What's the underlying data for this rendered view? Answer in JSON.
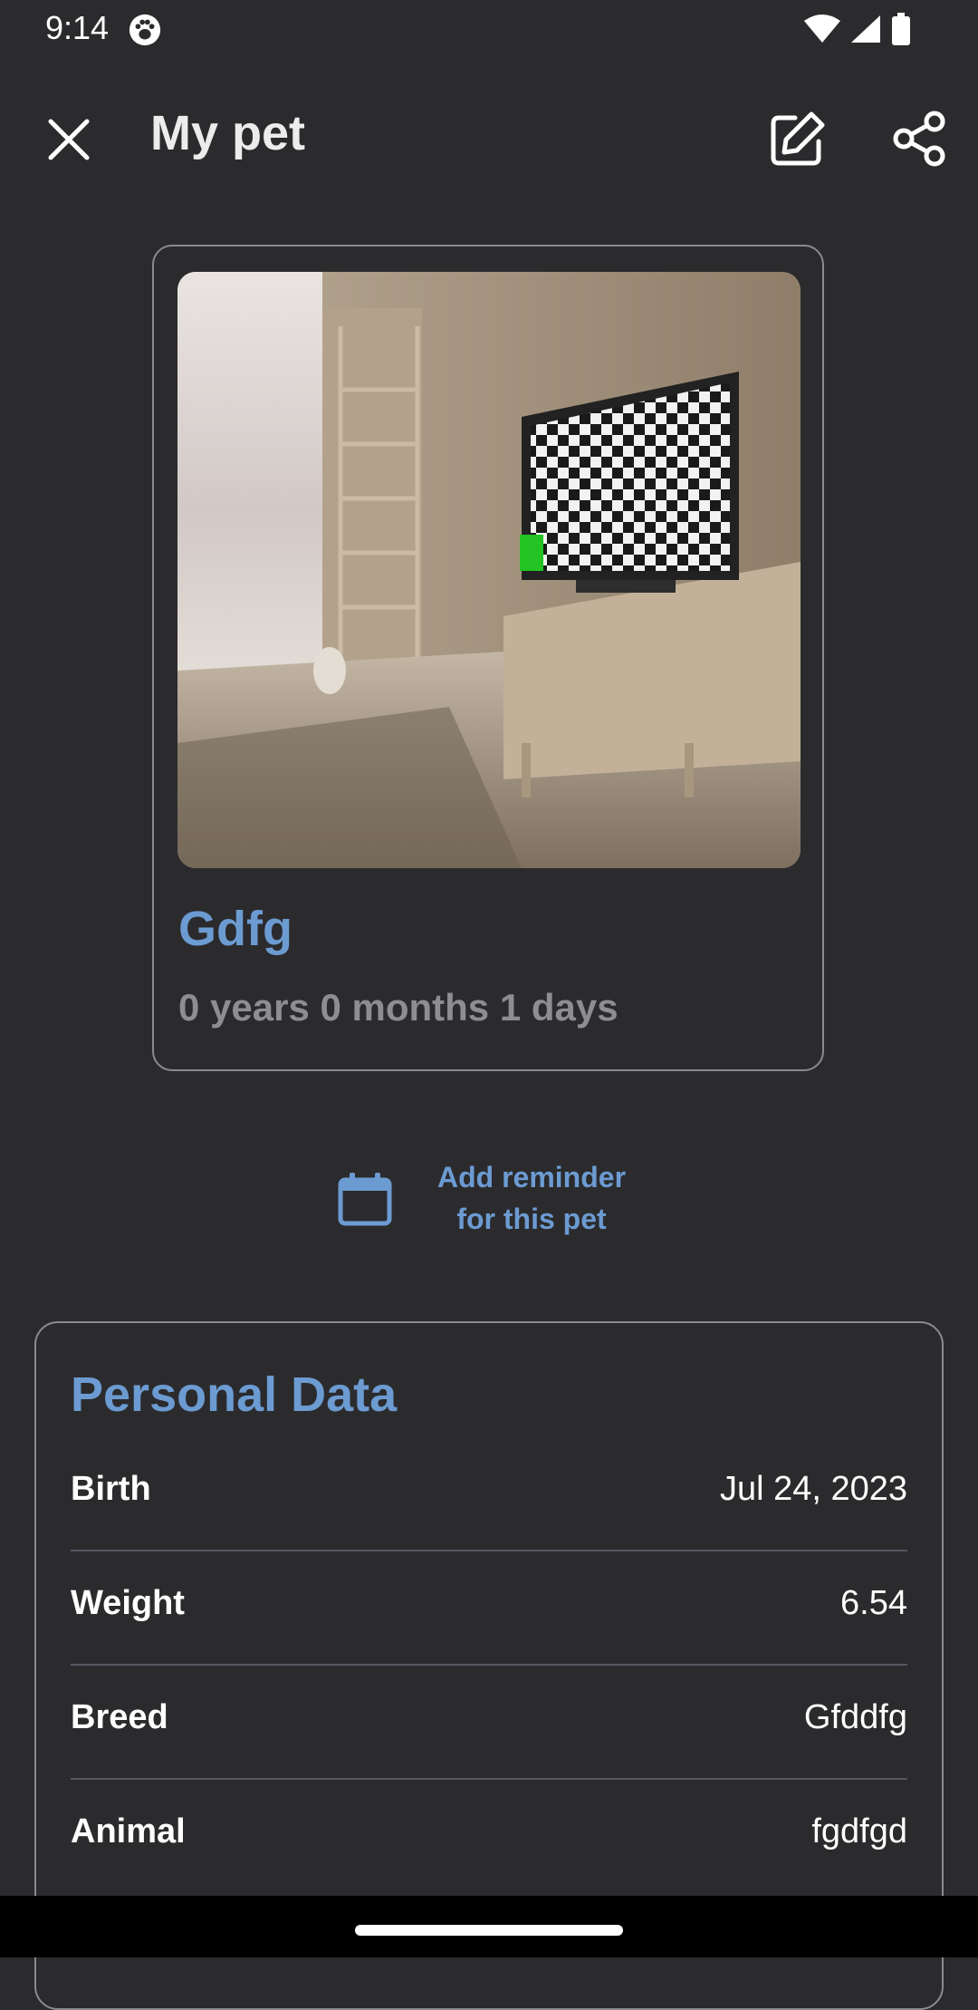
{
  "status_bar": {
    "time": "9:14",
    "icons": [
      "paw-icon",
      "wifi-icon",
      "signal-icon",
      "battery-icon"
    ]
  },
  "app_bar": {
    "title": "My pet",
    "close_icon": "close-icon",
    "edit_icon": "edit-icon",
    "share_icon": "share-icon"
  },
  "pet": {
    "name": "Gdfg",
    "age": "0 years 0 months 1 days"
  },
  "reminder": {
    "line1": "Add reminder",
    "line2": "for this pet",
    "icon": "calendar-icon"
  },
  "personal_data": {
    "title": "Personal Data",
    "rows": [
      {
        "label": "Birth",
        "value": "Jul 24, 2023"
      },
      {
        "label": "Weight",
        "value": "6.54"
      },
      {
        "label": "Breed",
        "value": "Gfddfg"
      },
      {
        "label": "Animal",
        "value": "fgdfgd"
      }
    ]
  },
  "colors": {
    "background": "#2b2b2d",
    "accent": "#6c9bd2",
    "muted": "#8e8e92",
    "border": "#8b8b8f"
  }
}
